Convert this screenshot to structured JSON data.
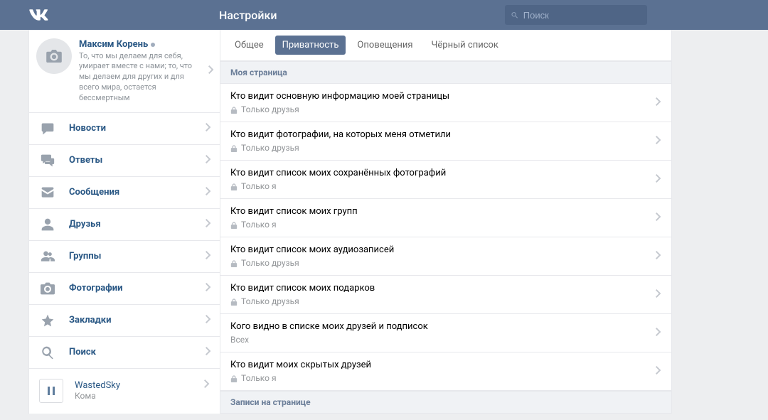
{
  "header": {
    "title": "Настройки",
    "search_placeholder": "Поиск"
  },
  "profile": {
    "name": "Максим Корень",
    "status": "То, что мы делаем для себя, умирает вместе с нами; то, что мы делаем для других и для всего мира, остается бессмертным"
  },
  "nav": {
    "news": "Новости",
    "replies": "Ответы",
    "messages": "Сообщения",
    "friends": "Друзья",
    "groups": "Группы",
    "photos": "Фотографии",
    "bookmarks": "Закладки",
    "search": "Поиск"
  },
  "player": {
    "artist": "WastedSky",
    "track": "Кома"
  },
  "tabs": {
    "general": "Общее",
    "privacy": "Приватность",
    "notifications": "Оповещения",
    "blacklist": "Чёрный список",
    "active": "privacy"
  },
  "sections": {
    "my_page": "Моя страница",
    "wall": "Записи на странице"
  },
  "values": {
    "only_friends": "Только друзья",
    "only_me": "Только я",
    "all": "Всех"
  },
  "rows": [
    {
      "q": "Кто видит основную информацию моей страницы",
      "v": "only_friends",
      "lock": true
    },
    {
      "q": "Кто видит фотографии, на которых меня отметили",
      "v": "only_friends",
      "lock": true
    },
    {
      "q": "Кто видит список моих сохранённых фотографий",
      "v": "only_me",
      "lock": true
    },
    {
      "q": "Кто видит список моих групп",
      "v": "only_me",
      "lock": true
    },
    {
      "q": "Кто видит список моих аудиозаписей",
      "v": "only_friends",
      "lock": true
    },
    {
      "q": "Кто видит список моих подарков",
      "v": "only_friends",
      "lock": true
    },
    {
      "q": "Кого видно в списке моих друзей и подписок",
      "v": "all",
      "lock": false
    },
    {
      "q": "Кто видит моих скрытых друзей",
      "v": "only_me",
      "lock": true
    }
  ]
}
